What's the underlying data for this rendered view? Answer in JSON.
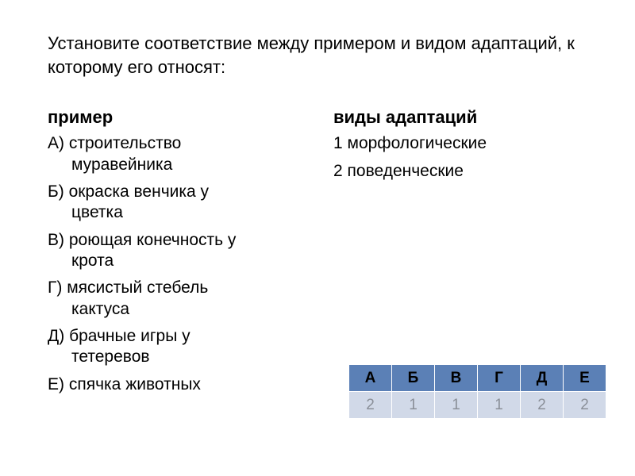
{
  "instruction": "Установите соответствие между примером и видом адаптаций, к которому его относят:",
  "left": {
    "heading": "пример",
    "items": [
      {
        "marker": "А)",
        "text": "строительство муравейника"
      },
      {
        "marker": "Б)",
        "text": "окраска венчика  у цветка"
      },
      {
        "marker": "В)",
        "text": "роющая конечность у крота"
      },
      {
        "marker": "Г)",
        "text": "мясистый стебель кактуса"
      },
      {
        "marker": "Д)",
        "text": "брачные игры у тетеревов"
      },
      {
        "marker": "Е)",
        "text": "спячка животных"
      }
    ]
  },
  "right": {
    "heading": "виды адаптаций",
    "items": [
      {
        "text": "1 морфологические"
      },
      {
        "text": "2 поведенческие"
      }
    ]
  },
  "answer_table": {
    "headers": [
      "А",
      "Б",
      "В",
      "Г",
      "Д",
      "Е"
    ],
    "values": [
      "2",
      "1",
      "1",
      "1",
      "2",
      "2"
    ]
  }
}
